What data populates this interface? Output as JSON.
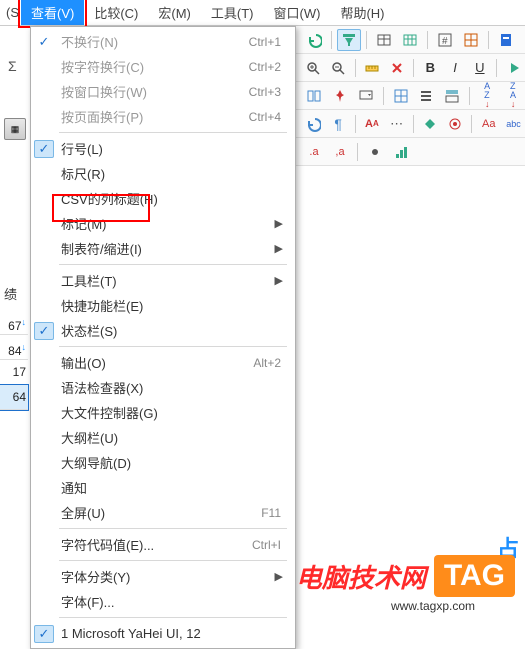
{
  "menubar": {
    "frag_left": "(S",
    "active": "查看(V)",
    "items": [
      "比较(C)",
      "宏(M)",
      "工具(T)",
      "窗口(W)",
      "帮助(H)"
    ]
  },
  "dropdown": {
    "groups": [
      [
        {
          "label": "不换行(N)",
          "accel": "Ctrl+1",
          "check": true,
          "disabled": true
        },
        {
          "label": "按字符换行(C)",
          "accel": "Ctrl+2",
          "disabled": true
        },
        {
          "label": "按窗口换行(W)",
          "accel": "Ctrl+3",
          "disabled": true
        },
        {
          "label": "按页面换行(P)",
          "accel": "Ctrl+4",
          "disabled": true
        }
      ],
      [
        {
          "label": "行号(L)",
          "check": true,
          "checked_bg": true
        },
        {
          "label": "标尺(R)"
        },
        {
          "label": "CSV的列标题(H)"
        },
        {
          "label": "标记(M)",
          "submenu": true,
          "highlight": true
        },
        {
          "label": "制表符/缩进(I)",
          "submenu": true
        }
      ],
      [
        {
          "label": "工具栏(T)",
          "submenu": true
        },
        {
          "label": "快捷功能栏(E)"
        },
        {
          "label": "状态栏(S)",
          "check": true,
          "checked_bg": true
        }
      ],
      [
        {
          "label": "输出(O)",
          "accel": "Alt+2"
        },
        {
          "label": "语法检查器(X)"
        },
        {
          "label": "大文件控制器(G)"
        },
        {
          "label": "大纲栏(U)"
        },
        {
          "label": "大纲导航(D)"
        },
        {
          "label": "通知"
        },
        {
          "label": "全屏(U)",
          "accel": "F11"
        }
      ],
      [
        {
          "label": "字符代码值(E)...",
          "accel": "Ctrl+I"
        }
      ],
      [
        {
          "label": "字体分类(Y)",
          "submenu": true
        },
        {
          "label": "字体(F)..."
        }
      ],
      [
        {
          "label": "1 Microsoft YaHei UI, 12",
          "check": true,
          "checked_bg": true
        }
      ]
    ]
  },
  "left": {
    "sigma": "Σ",
    "calc": "▦"
  },
  "sheet": {
    "header_frag": "绩",
    "cells": [
      "67",
      "84",
      "17",
      "64"
    ],
    "arrows": [
      "↓",
      "↓",
      "",
      ""
    ]
  },
  "toolbar_icons": {
    "undo": "↶",
    "sheet": "▦",
    "filter": "▼",
    "table": "▦",
    "sheet2": "▦",
    "num": "⊞",
    "grid": "▦",
    "blue": "◉",
    "split": "◫",
    "pin": "📌",
    "drop": "▾",
    "pane": "⊞",
    "list": "☰",
    "layout": "▤",
    "sort_az": "A↓",
    "sort_za": "Z↓",
    "undo2": "↶",
    "para": "¶",
    "red_a": "AA",
    "dots": "…",
    "green": "◆",
    "target": "◎",
    "red_aa": "Aa",
    "abc": "abc",
    "zoom_in": "🔍",
    "zoom_out": "🔍",
    "ruler": "📏",
    "x": "✕",
    "bold": "B",
    "italic": "I",
    "under": "U",
    "play": "▶"
  },
  "watermark": {
    "text": "电脑技术网",
    "tag": "TAG",
    "site": "www.tagxp.com",
    "frag": "占"
  }
}
